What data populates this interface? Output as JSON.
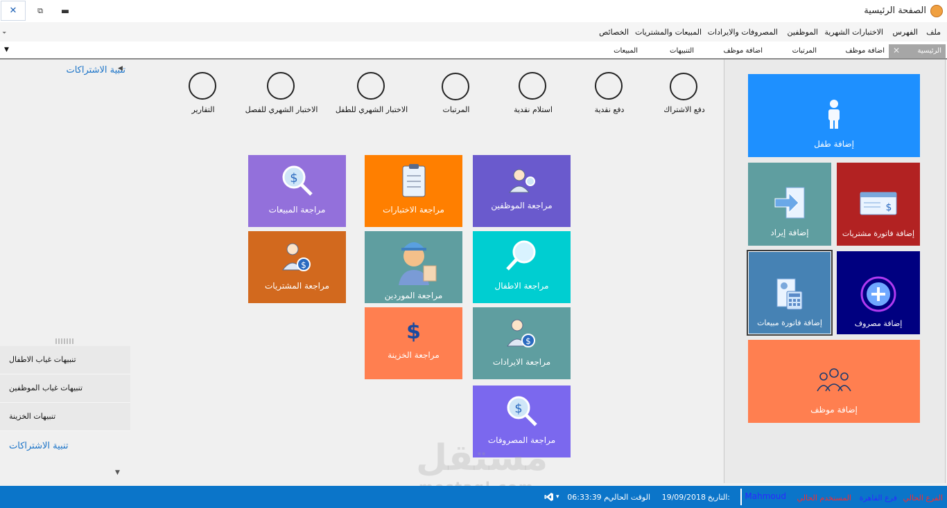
{
  "window": {
    "title": "الصفحة الرئيسية",
    "close_glyph": "✕",
    "restore_glyph": "⧉",
    "minimize_glyph": "▬"
  },
  "menu": {
    "items": [
      "ملف",
      "الفهرس",
      "الاختبارات الشهرية",
      "الموظفين",
      "المصروفات والايرادات",
      "المبيعات والمشتريات",
      "الخصائص"
    ],
    "overflow_glyph": "⏷"
  },
  "tabs": {
    "active": "الرئيسية",
    "active_close": "✕",
    "items": [
      "اضافة موظف",
      "المرتبات",
      "اضافة موظف",
      "التنبيهات",
      "المبيعات"
    ],
    "dropdown_glyph": "▼"
  },
  "left_panel": {
    "header": "تنبية الاشتراكات",
    "collapse_glyph": "◀",
    "items": [
      "تنبيهات غياب الاطفال",
      "تنبيهات غياب الموظفين",
      "تنبيهات الخزينة"
    ],
    "footer": "تنبية الاشتراكات",
    "scroll_glyph": "▼"
  },
  "shortcuts": [
    "دفع الاشتراك",
    "دفع نقدية",
    "استلام نقدية",
    "المرتبات",
    "الاختبار الشهري للطفل",
    "الاختبار الشهري للفصل",
    "التقارير"
  ],
  "review_tiles": {
    "employees": {
      "label": "مراجعة الموظفين",
      "color": "#6a5acd"
    },
    "tests": {
      "label": "مراجعة الاختبارات",
      "color": "#ff7f00"
    },
    "sales": {
      "label": "مراجعة المبيعات",
      "color": "#9370db"
    },
    "children": {
      "label": "مراجعة الاطفال",
      "color": "#00ced1"
    },
    "suppliers": {
      "label": "مراجعة الموردين",
      "color": "#5f9ea0"
    },
    "purchases": {
      "label": "مراجعة المشتريات",
      "color": "#d2691e"
    },
    "revenues": {
      "label": "مراجعة الايرادات",
      "color": "#5f9ea0"
    },
    "treasury": {
      "label": "مراجعة الخزينة",
      "color": "#ff7f50"
    },
    "expenses": {
      "label": "مراجعة المصروفات",
      "color": "#7b68ee"
    }
  },
  "action_tiles": {
    "add_child": {
      "label": "إضافة طفل",
      "color": "#1e90ff"
    },
    "add_purchase_invoice": {
      "label": "إضافة فاتورة مشتريات",
      "color": "#b22222"
    },
    "add_revenue": {
      "label": "إضافة إيراد",
      "color": "#5f9ea0"
    },
    "add_expense": {
      "label": "إضافة مصروف",
      "color": "#000080"
    },
    "add_sales_invoice": {
      "label": "إضافة فاتورة مبيعات",
      "color": "#4682b4"
    },
    "add_employee": {
      "label": "إضافة موظف",
      "color": "#ff7f50"
    }
  },
  "watermark": {
    "arabic": "مستقل",
    "latin": "mostaql.com"
  },
  "status": {
    "branch_label": "الفرع الحالي",
    "branch_value": "فرع القاهرة",
    "user_label": "المستخدم الحالي",
    "user_value": "Mahmoud",
    "date_label": "التاريخ:",
    "date_value": "19/09/2018",
    "time_label": "الوقت الحالي",
    "time_value": "06:33:39 م",
    "dropdown_glyph": "▾",
    "colors": {
      "bar": "#0b75c9",
      "branch_label": "#ff2a2a",
      "branch_value": "#2a2aff",
      "user_label": "#ff2a2a",
      "user_value": "#2a2aff"
    }
  }
}
